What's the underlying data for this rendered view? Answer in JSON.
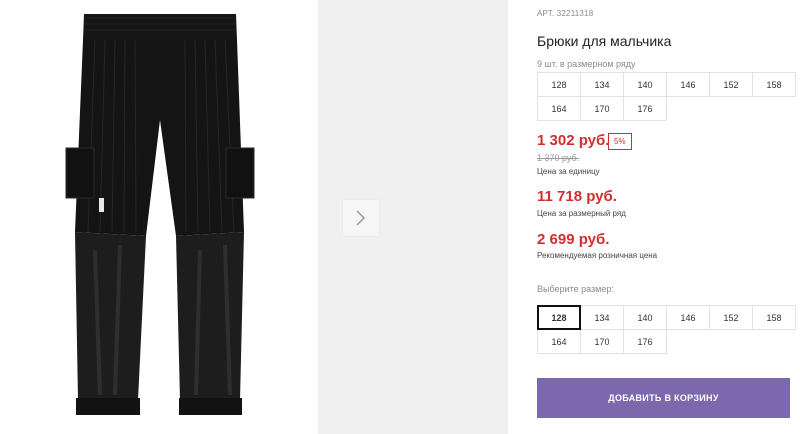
{
  "product": {
    "article": "АРТ. 32211318",
    "title": "Брюки для мальчика"
  },
  "pack": {
    "note": "9 шт. в размерном ряду",
    "sizes": [
      "128",
      "134",
      "140",
      "146",
      "152",
      "158",
      "164",
      "170",
      "176"
    ]
  },
  "prices": {
    "unit_price": "1 302 руб.",
    "discount": "5%",
    "old_price": "1 370 руб.",
    "unit_label": "Цена за единицу",
    "row_price": "11 718 руб.",
    "row_label": "Цена за размерный ряд",
    "rrp_price": "2 699 руб.",
    "rrp_label": "Рекомендуемая розничная цена"
  },
  "size_select": {
    "label": "Выберите размер:",
    "selected": "128",
    "sizes": [
      "128",
      "134",
      "140",
      "146",
      "152",
      "158",
      "164",
      "170",
      "176"
    ]
  },
  "cart": {
    "add_label": "ДОБАВИТЬ В КОРЗИНУ"
  },
  "colors": {
    "accent": "#7d68ad",
    "price": "#d42d2d"
  },
  "icons": {
    "next": "chevron-right-icon"
  }
}
